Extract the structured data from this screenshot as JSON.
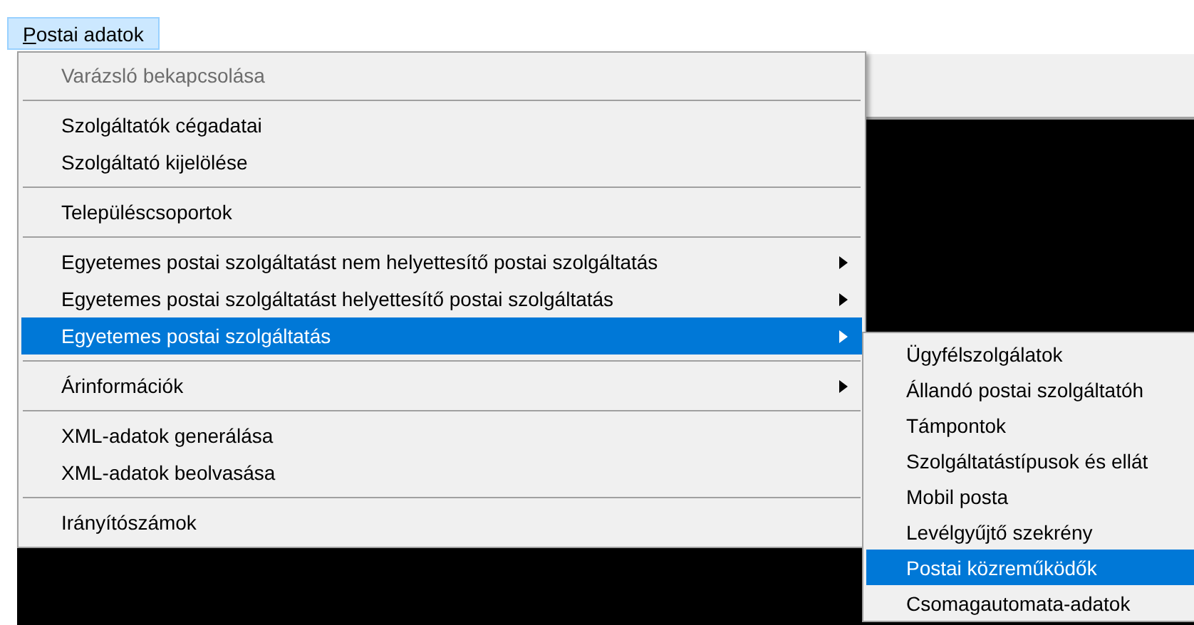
{
  "menu_bar": [
    {
      "label": "Postai adatok",
      "selected": true
    }
  ],
  "menu": {
    "groups": [
      [
        {
          "label": "Varázsló bekapcsolása",
          "disabled": true,
          "has_submenu": false,
          "selected": false
        }
      ],
      [
        {
          "label": "Szolgáltatók cégadatai",
          "disabled": false,
          "has_submenu": false,
          "selected": false
        },
        {
          "label": "Szolgáltató kijelölése",
          "disabled": false,
          "has_submenu": false,
          "selected": false
        }
      ],
      [
        {
          "label": "Településcsoportok",
          "disabled": false,
          "has_submenu": false,
          "selected": false
        }
      ],
      [
        {
          "label": "Egyetemes postai szolgáltatást nem helyettesítő postai szolgáltatás",
          "disabled": false,
          "has_submenu": true,
          "selected": false
        },
        {
          "label": "Egyetemes postai szolgáltatást helyettesítő postai szolgáltatás",
          "disabled": false,
          "has_submenu": true,
          "selected": false
        },
        {
          "label": "Egyetemes postai szolgáltatás",
          "disabled": false,
          "has_submenu": true,
          "selected": true
        }
      ],
      [
        {
          "label": "Árinformációk",
          "disabled": false,
          "has_submenu": true,
          "selected": false
        }
      ],
      [
        {
          "label": "XML-adatok generálása",
          "disabled": false,
          "has_submenu": false,
          "selected": false
        },
        {
          "label": "XML-adatok beolvasása",
          "disabled": false,
          "has_submenu": false,
          "selected": false
        }
      ],
      [
        {
          "label": "Irányítószámok",
          "disabled": false,
          "has_submenu": false,
          "selected": false
        }
      ]
    ]
  },
  "submenu": {
    "items": [
      {
        "label": "Ügyfélszolgálatok",
        "selected": false
      },
      {
        "label": "Állandó postai szolgáltatóh",
        "selected": false
      },
      {
        "label": "Támpontok",
        "selected": false
      },
      {
        "label": "Szolgáltatástípusok és ellát",
        "selected": false
      },
      {
        "label": "Mobil posta",
        "selected": false
      },
      {
        "label": "Levélgyűjtő szekrény",
        "selected": false
      },
      {
        "label": "Postai közreműködők",
        "selected": true
      },
      {
        "label": "Csomagautomata-adatok",
        "selected": false
      }
    ]
  }
}
